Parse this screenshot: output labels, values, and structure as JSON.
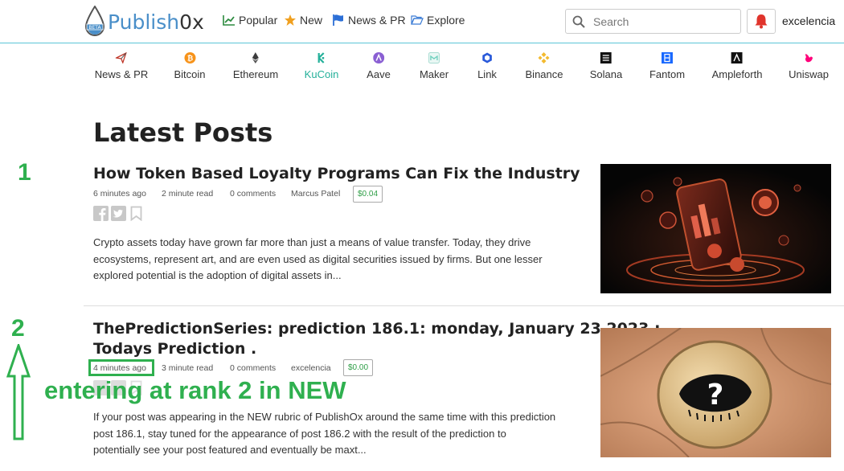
{
  "header": {
    "logo_text": "Publish",
    "logo_zero": "0x",
    "logo_badge": "BETA",
    "nav": [
      {
        "label": "Popular",
        "icon": "chart-line-icon"
      },
      {
        "label": "New",
        "icon": "star-icon"
      },
      {
        "label": "News & PR",
        "icon": "flag-icon"
      },
      {
        "label": "Explore",
        "icon": "folder-open-icon"
      }
    ],
    "search_placeholder": "Search",
    "username": "excelencia"
  },
  "coins": [
    {
      "label": "News & PR",
      "icon": "news-paper-plane-icon",
      "color": "#c0392b"
    },
    {
      "label": "Bitcoin",
      "icon": "bitcoin-icon",
      "color": "#f7931a"
    },
    {
      "label": "Ethereum",
      "icon": "ethereum-icon",
      "color": "#3c3c3d"
    },
    {
      "label": "KuCoin",
      "icon": "kucoin-icon",
      "color": "#24b09a"
    },
    {
      "label": "Aave",
      "icon": "aave-icon",
      "color": "#8a5fd3"
    },
    {
      "label": "Maker",
      "icon": "maker-icon",
      "color": "#6acebb"
    },
    {
      "label": "Link",
      "icon": "chainlink-icon",
      "color": "#2a5ada"
    },
    {
      "label": "Binance",
      "icon": "binance-icon",
      "color": "#f3ba2f"
    },
    {
      "label": "Solana",
      "icon": "solana-icon",
      "color": "#111111"
    },
    {
      "label": "Fantom",
      "icon": "fantom-icon",
      "color": "#1969ff"
    },
    {
      "label": "Ampleforth",
      "icon": "ampleforth-icon",
      "color": "#111111"
    },
    {
      "label": "Uniswap",
      "icon": "uniswap-icon",
      "color": "#ff007a"
    }
  ],
  "page_title": "Latest Posts",
  "posts": [
    {
      "rank": "1",
      "title_lines": [
        "How Token Based Loyalty Programs Can Fix the Industry"
      ],
      "time": "6 minutes ago",
      "read": "2 minute read",
      "comments": "0 comments",
      "author": "Marcus Patel",
      "tip": "$0.04",
      "excerpt_lines": [
        "Crypto assets today have grown far more than just a means of value transfer. Today, they drive",
        "ecosystems, represent art, and are even used as digital securities issued by firms. But one lesser",
        "explored potential is the adoption of digital assets in..."
      ]
    },
    {
      "rank": "2",
      "title_lines": [
        "ThePredictionSeries: prediction 186.1: monday, January 23 2023 :",
        "Todays Prediction ."
      ],
      "time": "4 minutes ago",
      "read": "3 minute read",
      "comments": "0 comments",
      "author": "excelencia",
      "tip": "$0.00",
      "excerpt_lines": [
        "If your post was appearing in the NEW rubric of PublishOx around the same time with this prediction",
        "post 186.1, stay tuned for the appearance of post 186.2 with the result of the prediction to",
        "potentially see your post featured and eventually be maxt..."
      ]
    }
  ],
  "annotation": "entering at rank 2 in NEW",
  "colors": {
    "accent": "#2fb04f",
    "link": "#4a8fc9",
    "bell": "#e0342c"
  }
}
